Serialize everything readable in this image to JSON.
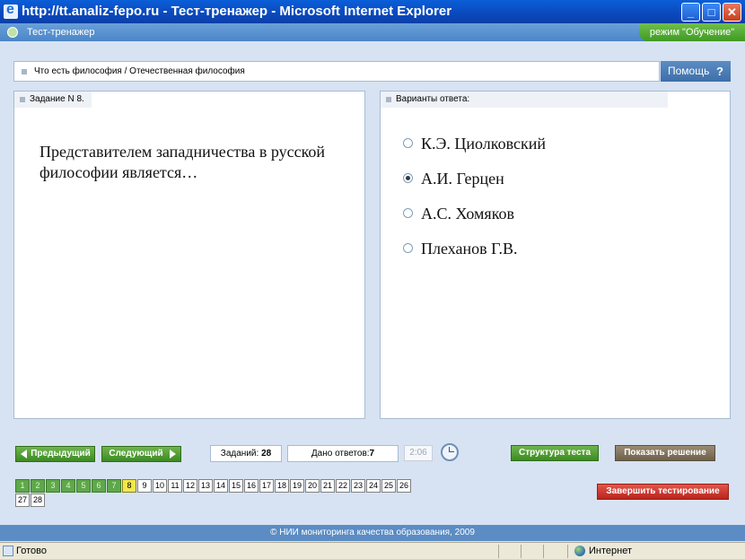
{
  "window": {
    "title": "http://tt.analiz-fepo.ru - Тест-тренажер - Microsoft Internet Explorer"
  },
  "app": {
    "name": "Тест-тренажер",
    "mode": "режим \"Обучение\""
  },
  "breadcrumb": "Что есть философия / Отечественная философия",
  "help_label": "Помощь",
  "help_icon": "?",
  "task": {
    "header": "Задание N 8.",
    "question": "Представителем западничества в русской философии является…"
  },
  "answers": {
    "header": "Варианты ответа:",
    "options": [
      "К.Э. Циолковский",
      "А.И. Герцен",
      "А.С. Хомяков",
      "Плеханов Г.В."
    ],
    "selected_index": 1
  },
  "navigation": {
    "prev_label": "Предыдущий",
    "next_label": "Следующий",
    "tasks_label": "Заданий:",
    "tasks_count": "28",
    "answered_label": "Дано ответов:",
    "answered_count": "7",
    "timer": "2:06",
    "structure_label": "Структура теста",
    "solution_label": "Показать решение",
    "finish_label": "Завершить тестирование"
  },
  "question_numbers": [
    "1",
    "2",
    "3",
    "4",
    "5",
    "6",
    "7",
    "8",
    "9",
    "10",
    "11",
    "12",
    "13",
    "14",
    "15",
    "16",
    "17",
    "18",
    "19",
    "20",
    "21",
    "22",
    "23",
    "24",
    "25",
    "26",
    "27",
    "28"
  ],
  "answered_numbers": [
    1,
    2,
    3,
    4,
    5,
    6,
    7
  ],
  "current_number": 8,
  "footer": "© НИИ мониторинга качества образования, 2009",
  "status": {
    "left": "Готово",
    "zone": "Интернет"
  },
  "colors": {
    "answered": "#5fa84a",
    "current": "#f2e84b",
    "accent_blue": "#5b8cc4",
    "finish_red": "#c8342a"
  }
}
